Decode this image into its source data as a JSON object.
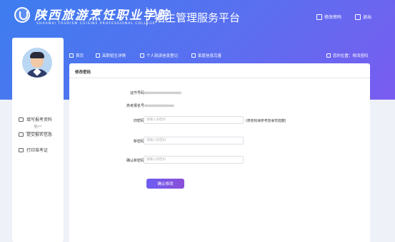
{
  "header": {
    "school_name_cn": "陕西旅游烹饪职业学院",
    "school_name_en": "SHAANXI TOURISM CUISINE PROFESSIONAL COLLEGE",
    "platform_title": "招生管理服务平台",
    "change_password_link": "修改密码",
    "logout_link": "退出"
  },
  "sidebar": {
    "student_name": "陈**",
    "items": [
      {
        "label": "填写报考资料",
        "icon": "id-card-icon"
      },
      {
        "label": "提交报名信息",
        "icon": "document-icon"
      },
      {
        "label": "打印准考证",
        "icon": "printer-icon"
      }
    ]
  },
  "topnav": {
    "items": [
      {
        "label": "首页",
        "icon": "home-icon"
      },
      {
        "label": "高职招生详情",
        "icon": "list-icon"
      },
      {
        "label": "个人就读信息登记",
        "icon": "user-icon"
      },
      {
        "label": "家庭信息完善",
        "icon": "folder-icon"
      }
    ],
    "location_text": "您的位置：修改密码"
  },
  "form": {
    "title": "修改密码",
    "id_number_label": "证件号码：",
    "exam_number_label": "高考报名号：",
    "old_password_label": "旧密码：",
    "old_password_placeholder": "请输入旧密码",
    "old_password_hint": "(原密码请参考登录页提醒)",
    "new_password_label": "新密码：",
    "new_password_placeholder": "请输入新密码",
    "confirm_password_label": "确认新密码：",
    "confirm_password_placeholder": "请输入新密码",
    "confirm_button": "确认修改"
  },
  "colors": {
    "header_gradient_start": "#3d7df0",
    "header_gradient_end": "#7a5cf0",
    "button_gradient_start": "#6d5cf2",
    "button_gradient_end": "#8a4fd8"
  }
}
